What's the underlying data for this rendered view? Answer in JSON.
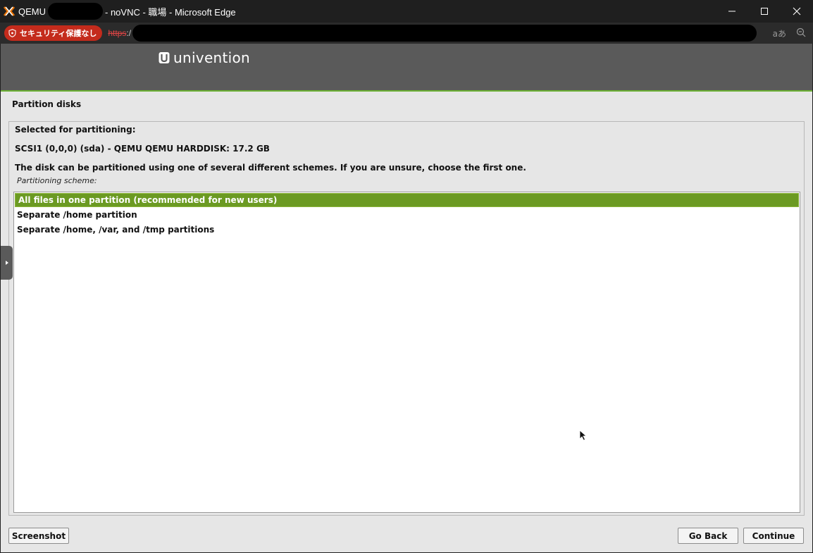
{
  "window": {
    "title_prefix": "QEMU",
    "title_suffix": "- noVNC - 職場 - Microsoft Edge",
    "icons": [
      "proxmox-icon",
      "minimize-icon",
      "maximize-icon",
      "close-icon"
    ]
  },
  "addressbar": {
    "security_label": "セキュリティ保護なし",
    "url_scheme": "https",
    "url_separator": ":/",
    "read_aloud_label": "aあ",
    "icons": [
      "shield-icon",
      "read-aloud-icon",
      "zoom-out-icon"
    ]
  },
  "installer": {
    "brand": "univention",
    "section_title": "Partition disks",
    "selected_label": "Selected for partitioning:",
    "disk": "SCSI1 (0,0,0) (sda) - QEMU QEMU HARDDISK: 17.2 GB",
    "instructions": "The disk can be partitioned using one of several different schemes. If you are unsure, choose the first one.",
    "scheme_label": "Partitioning scheme:",
    "options": [
      "All files in one partition (recommended for new users)",
      "Separate /home partition",
      "Separate /home, /var, and /tmp partitions"
    ],
    "selected_option": 0
  },
  "buttons": {
    "screenshot": "Screenshot",
    "go_back": "Go Back",
    "continue": "Continue"
  },
  "colors": {
    "selection": "#6b9a22",
    "header": "#5a5a5a",
    "accent_line": "#6bb033",
    "security_badge": "#c42b1c"
  }
}
